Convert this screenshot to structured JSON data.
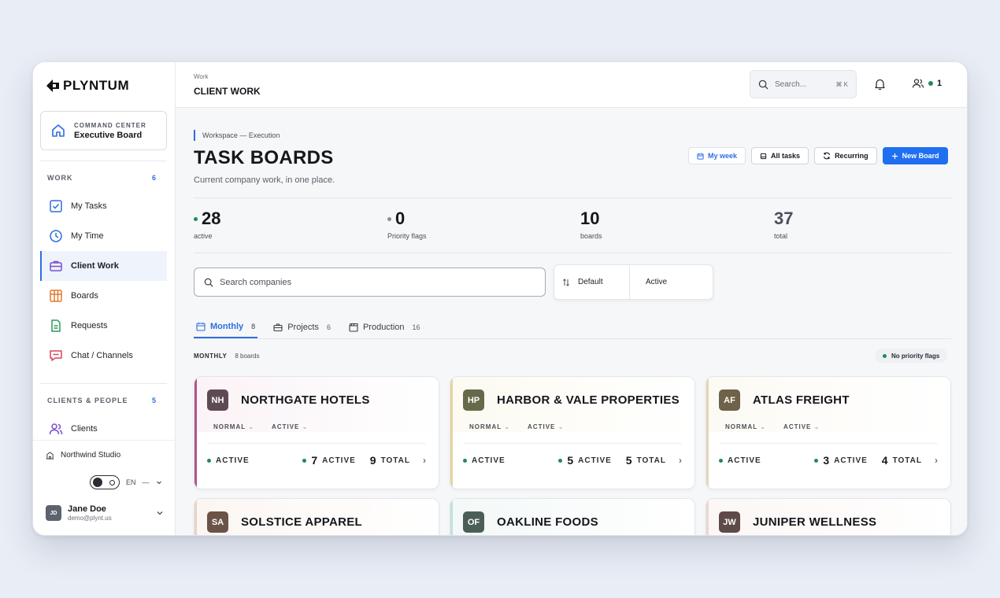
{
  "brand": "PLYNTUM",
  "command_center": {
    "label": "COMMAND CENTER",
    "title": "Executive Board"
  },
  "sidebar": {
    "work_header": "WORK",
    "work_count": "6",
    "work_items": [
      "My Tasks",
      "My Time",
      "Client Work",
      "Boards",
      "Requests",
      "Chat / Channels"
    ],
    "clients_header": "CLIENTS & PEOPLE",
    "clients_count": "5",
    "clients_items": [
      "Clients"
    ],
    "studio": "Northwind Studio",
    "lang": "EN",
    "user": {
      "initials": "JD",
      "name": "Jane Doe",
      "email": "demo@plynt.us"
    }
  },
  "topbar": {
    "crumb": "Work",
    "title": "CLIENT WORK",
    "search_placeholder": "Search...",
    "search_kbd": "⌘ K",
    "people_count": "1"
  },
  "main": {
    "workspace_label": "Workspace — Execution",
    "title": "TASK BOARDS",
    "subtitle": "Current company work, in one place.",
    "actions": {
      "my_week": "My week",
      "all_tasks": "All tasks",
      "recurring": "Recurring",
      "new_board": "New Board"
    },
    "stats": [
      {
        "value": "28",
        "label": "active"
      },
      {
        "value": "0",
        "label": "Priority flags"
      },
      {
        "value": "10",
        "label": "boards"
      },
      {
        "value": "37",
        "label": "total"
      }
    ],
    "search_companies_placeholder": "Search companies",
    "sort": {
      "order": "Default",
      "status": "Active"
    },
    "tabs": [
      {
        "label": "Monthly",
        "count": "8"
      },
      {
        "label": "Projects",
        "count": "6"
      },
      {
        "label": "Production",
        "count": "16"
      }
    ],
    "section": {
      "label": "MONTHLY",
      "count": "8 boards",
      "badge": "No priority flags"
    },
    "tag_labels": {
      "priority": "NORMAL",
      "status": "ACTIVE"
    },
    "card_labels": {
      "state": "ACTIVE",
      "active": "ACTIVE",
      "total": "TOTAL"
    },
    "cards": [
      {
        "initials": "NH",
        "name": "NORTHGATE HOTELS",
        "active": "7",
        "total": "9",
        "avatar_color": "#5e4a55",
        "accent": "#b0558d",
        "glow": "#fbf3f7"
      },
      {
        "initials": "HP",
        "name": "HARBOR & VALE PROPERTIES",
        "active": "5",
        "total": "5",
        "avatar_color": "#666a48",
        "accent": "#e5d49f",
        "glow": "#fcfaf1"
      },
      {
        "initials": "AF",
        "name": "ATLAS FREIGHT",
        "active": "3",
        "total": "4",
        "avatar_color": "#6e6247",
        "accent": "#e4d6b6",
        "glow": "#fcfaf4"
      },
      {
        "initials": "SA",
        "name": "SOLSTICE APPAREL",
        "avatar_color": "#6b5347",
        "accent": "#ead2c4",
        "glow": "#fcf6f2"
      },
      {
        "initials": "OF",
        "name": "OAKLINE FOODS",
        "avatar_color": "#4c5e58",
        "accent": "#c5dfdc",
        "glow": "#f3f9f8"
      },
      {
        "initials": "JW",
        "name": "JUNIPER WELLNESS",
        "avatar_color": "#5e4a47",
        "accent": "#ead7d2",
        "glow": "#fcf7f5"
      }
    ]
  },
  "colors": {
    "accent": "#2f6de0",
    "primary_button": "#1f6ff2",
    "online": "#1f8a5a"
  }
}
